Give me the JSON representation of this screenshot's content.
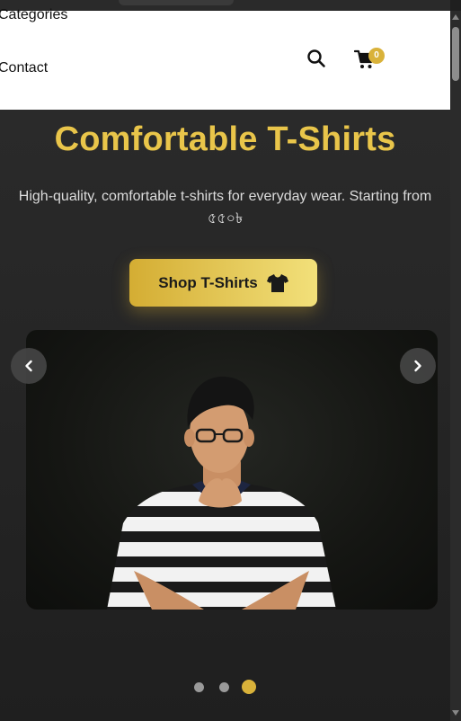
{
  "nav": {
    "links": [
      "Categories",
      "Contact"
    ],
    "search_icon": "search-icon",
    "cart_icon": "cart-icon",
    "cart_count": "0"
  },
  "hero": {
    "title": "Comfortable T-Shirts",
    "subtitle": "High-quality, comfortable t-shirts for everyday wear. Starting from ৫৫০৳",
    "button_label": "Shop T-Shirts",
    "button_icon": "tshirt-icon"
  },
  "carousel": {
    "prev_icon": "chevron-left-icon",
    "next_icon": "chevron-right-icon",
    "slide_count": 3,
    "active_index": 2
  },
  "colors": {
    "accent": "#e9c54a",
    "badge": "#d9b23a",
    "hero_bg": "#262626"
  }
}
